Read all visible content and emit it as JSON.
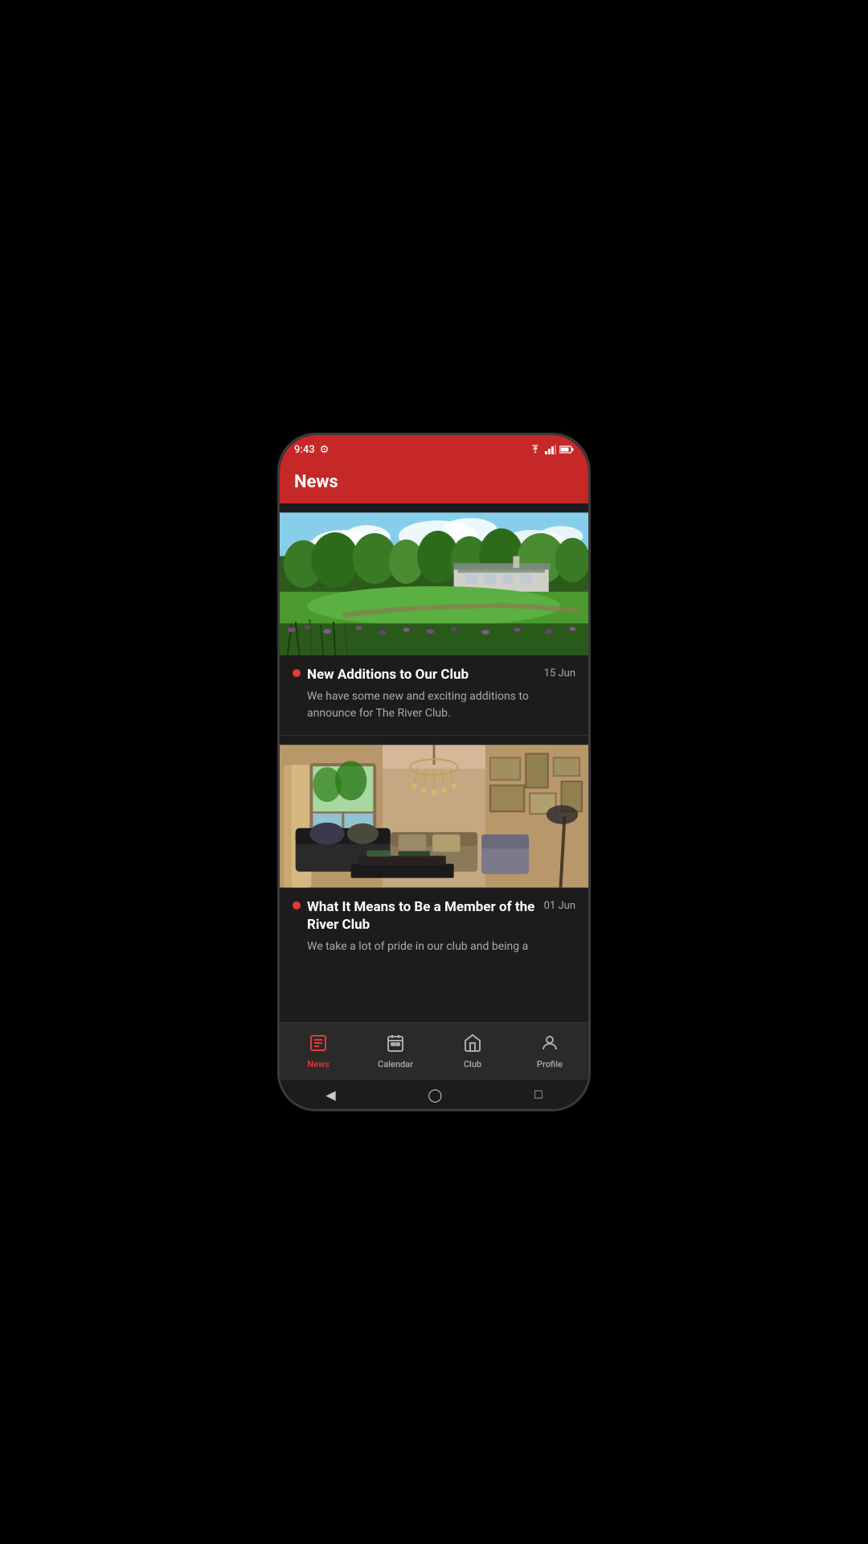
{
  "statusBar": {
    "time": "9:43",
    "settingsIcon": "⚙",
    "wifiIcon": "wifi",
    "signalIcon": "signal",
    "batteryIcon": "battery"
  },
  "header": {
    "title": "News"
  },
  "newsItems": [
    {
      "id": "article-1",
      "imageType": "golf",
      "title": "New Additions to Our Club",
      "date": "15 Jun",
      "excerpt": "We have some new and exciting additions to announce for The River Club."
    },
    {
      "id": "article-2",
      "imageType": "interior",
      "title": "What It Means to Be a Member of the River Club",
      "date": "01 Jun",
      "excerpt": "We take a lot of pride in our club and being a"
    }
  ],
  "bottomNav": {
    "items": [
      {
        "id": "news",
        "label": "News",
        "icon": "news",
        "active": true
      },
      {
        "id": "calendar",
        "label": "Calendar",
        "icon": "calendar",
        "active": false
      },
      {
        "id": "club",
        "label": "Club",
        "icon": "club",
        "active": false
      },
      {
        "id": "profile",
        "label": "Profile",
        "icon": "profile",
        "active": false
      }
    ]
  }
}
